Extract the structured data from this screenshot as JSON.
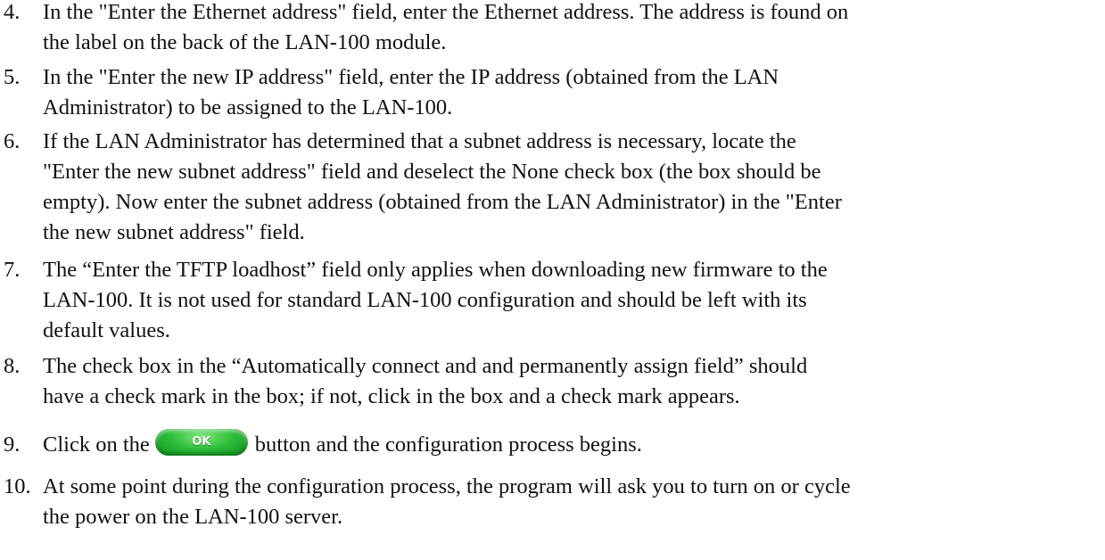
{
  "steps": [
    {
      "number": "4.",
      "lines": [
        "In the \"Enter the Ethernet address\" field, enter the Ethernet address. The address is found on",
        "the label on the back of the LAN-100 module."
      ]
    },
    {
      "number": "5.",
      "lines": [
        "In the \"Enter the new IP address\" field, enter the IP address (obtained from the LAN",
        "Administrator) to be assigned to the LAN-100."
      ]
    },
    {
      "number": "6.",
      "lines": [
        "If the LAN Administrator has determined that a subnet address is necessary, locate the",
        "\"Enter the new subnet address\" field and deselect the None check box (the box should be",
        "empty). Now enter the subnet address (obtained from the LAN Administrator) in the \"Enter",
        "the new subnet address\" field."
      ]
    },
    {
      "number": "7.",
      "lines": [
        "The “Enter the TFTP loadhost” field only applies when downloading new firmware to the",
        "LAN-100. It is not used for standard LAN-100 configuration and should be left with its",
        "default values."
      ]
    },
    {
      "number": "8.",
      "lines": [
        "The check box in the “Automatically connect and and permanently assign field” should",
        "have a check mark in the box; if not, click in the box and a check mark appears."
      ]
    },
    {
      "number": "9.",
      "before": "Click on the",
      "button_label": "OK",
      "after": "button and the configuration process begins."
    },
    {
      "number": "10.",
      "lines": [
        "At some point during the configuration process, the program will ask you to turn on or cycle",
        "the power on the LAN-100 server."
      ]
    }
  ]
}
